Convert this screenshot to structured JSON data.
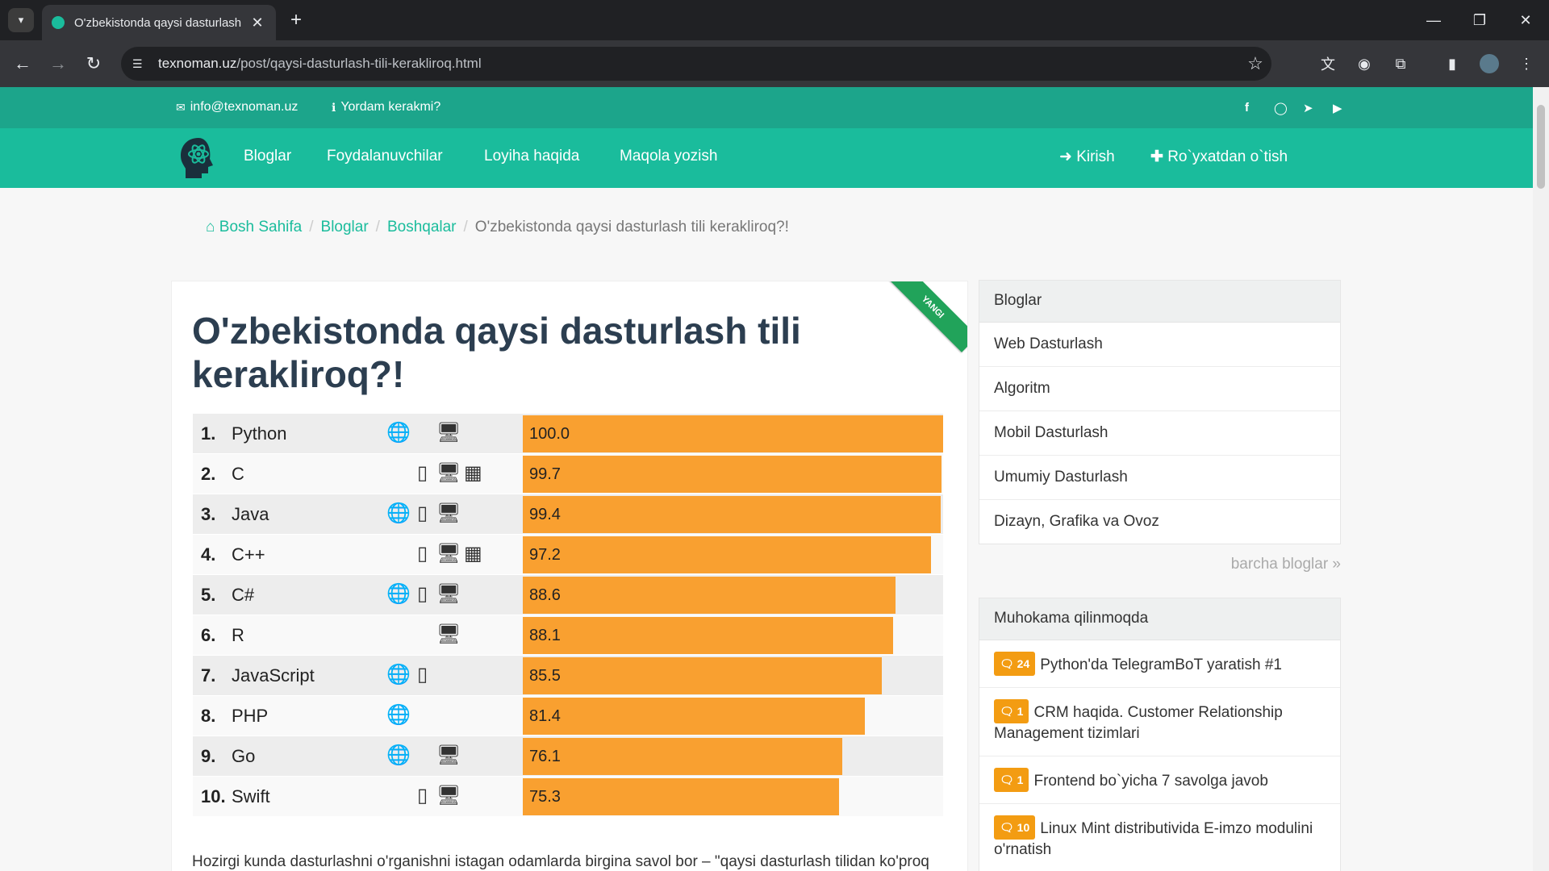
{
  "browser": {
    "tab_title": "O'zbekistonda qaysi dasturlash",
    "url_host": "texnoman.uz",
    "url_path": "/post/qaysi-dasturlash-tili-kerakliroq.html"
  },
  "topbar": {
    "email": "info@texnoman.uz",
    "help": "Yordam kerakmi?",
    "social_icons": [
      "facebook-icon",
      "github-icon",
      "telegram-icon",
      "youtube-icon"
    ]
  },
  "nav": {
    "items": [
      "Bloglar",
      "Foydalanuvchilar",
      "Loyiha haqida",
      "Maqola yozish"
    ],
    "login": "Kirish",
    "register": "Ro`yxatdan o`tish"
  },
  "breadcrumb": {
    "home": "Bosh Sahifa",
    "blogs": "Bloglar",
    "other": "Boshqalar",
    "current": "O'zbekistonda qaysi dasturlash tili kerakliroq?!"
  },
  "article": {
    "ribbon": "YANGI",
    "title": "O'zbekistonda qaysi dasturlash tili kerakliroq?!",
    "paragraph": "Hozirgi kunda dasturlashni o'rganishni istagan odamlarda birgina savol bor – \"qaysi dasturlash tilidan ko'proq foyda ko'raman\". Aslini olganda hozirda aktual bo'lgan dasturlash tillari u qadar"
  },
  "chart_data": {
    "type": "bar",
    "categories": [
      "Python",
      "C",
      "Java",
      "C++",
      "C#",
      "R",
      "JavaScript",
      "PHP",
      "Go",
      "Swift"
    ],
    "ranks": [
      "1.",
      "2.",
      "3.",
      "4.",
      "5.",
      "6.",
      "7.",
      "8.",
      "9.",
      "10."
    ],
    "values": [
      100.0,
      99.7,
      99.4,
      97.2,
      88.6,
      88.1,
      85.5,
      81.4,
      76.1,
      75.3
    ],
    "labels": [
      "100.0",
      "99.7",
      "99.4",
      "97.2",
      "88.6",
      "88.1",
      "85.5",
      "81.4",
      "76.1",
      "75.3"
    ],
    "platforms": [
      [
        "web",
        "desktop"
      ],
      [
        "mobile",
        "desktop",
        "embedded"
      ],
      [
        "web",
        "mobile",
        "desktop"
      ],
      [
        "mobile",
        "desktop",
        "embedded"
      ],
      [
        "web",
        "mobile",
        "desktop"
      ],
      [
        "desktop"
      ],
      [
        "web",
        "mobile"
      ],
      [
        "web"
      ],
      [
        "web",
        "desktop"
      ],
      [
        "mobile",
        "desktop"
      ]
    ],
    "ylim": [
      0,
      100
    ],
    "bar_color": "#f9a030"
  },
  "sidebar": {
    "blogs_title": "Bloglar",
    "blogs": [
      "Web Dasturlash",
      "Algoritm",
      "Mobil Dasturlash",
      "Umumiy Dasturlash",
      "Dizayn, Grafika va Ovoz"
    ],
    "all_blogs": "barcha bloglar »",
    "discuss_title": "Muhokama qilinmoqda",
    "discussions": [
      {
        "count": "24",
        "text": "Python'da TelegramBoT yaratish #1"
      },
      {
        "count": "1",
        "text": "CRM haqida. Customer Relationship Management tizimlari"
      },
      {
        "count": "1",
        "text": "Frontend bo`yicha 7 savolga javob"
      },
      {
        "count": "10",
        "text": "Linux Mint distributivida E-imzo modulini o'rnatish"
      }
    ]
  },
  "colors": {
    "primary": "#1abc9c",
    "topbar": "#1ca58b",
    "badge": "#f39c12",
    "ribbon": "#21a35a"
  }
}
